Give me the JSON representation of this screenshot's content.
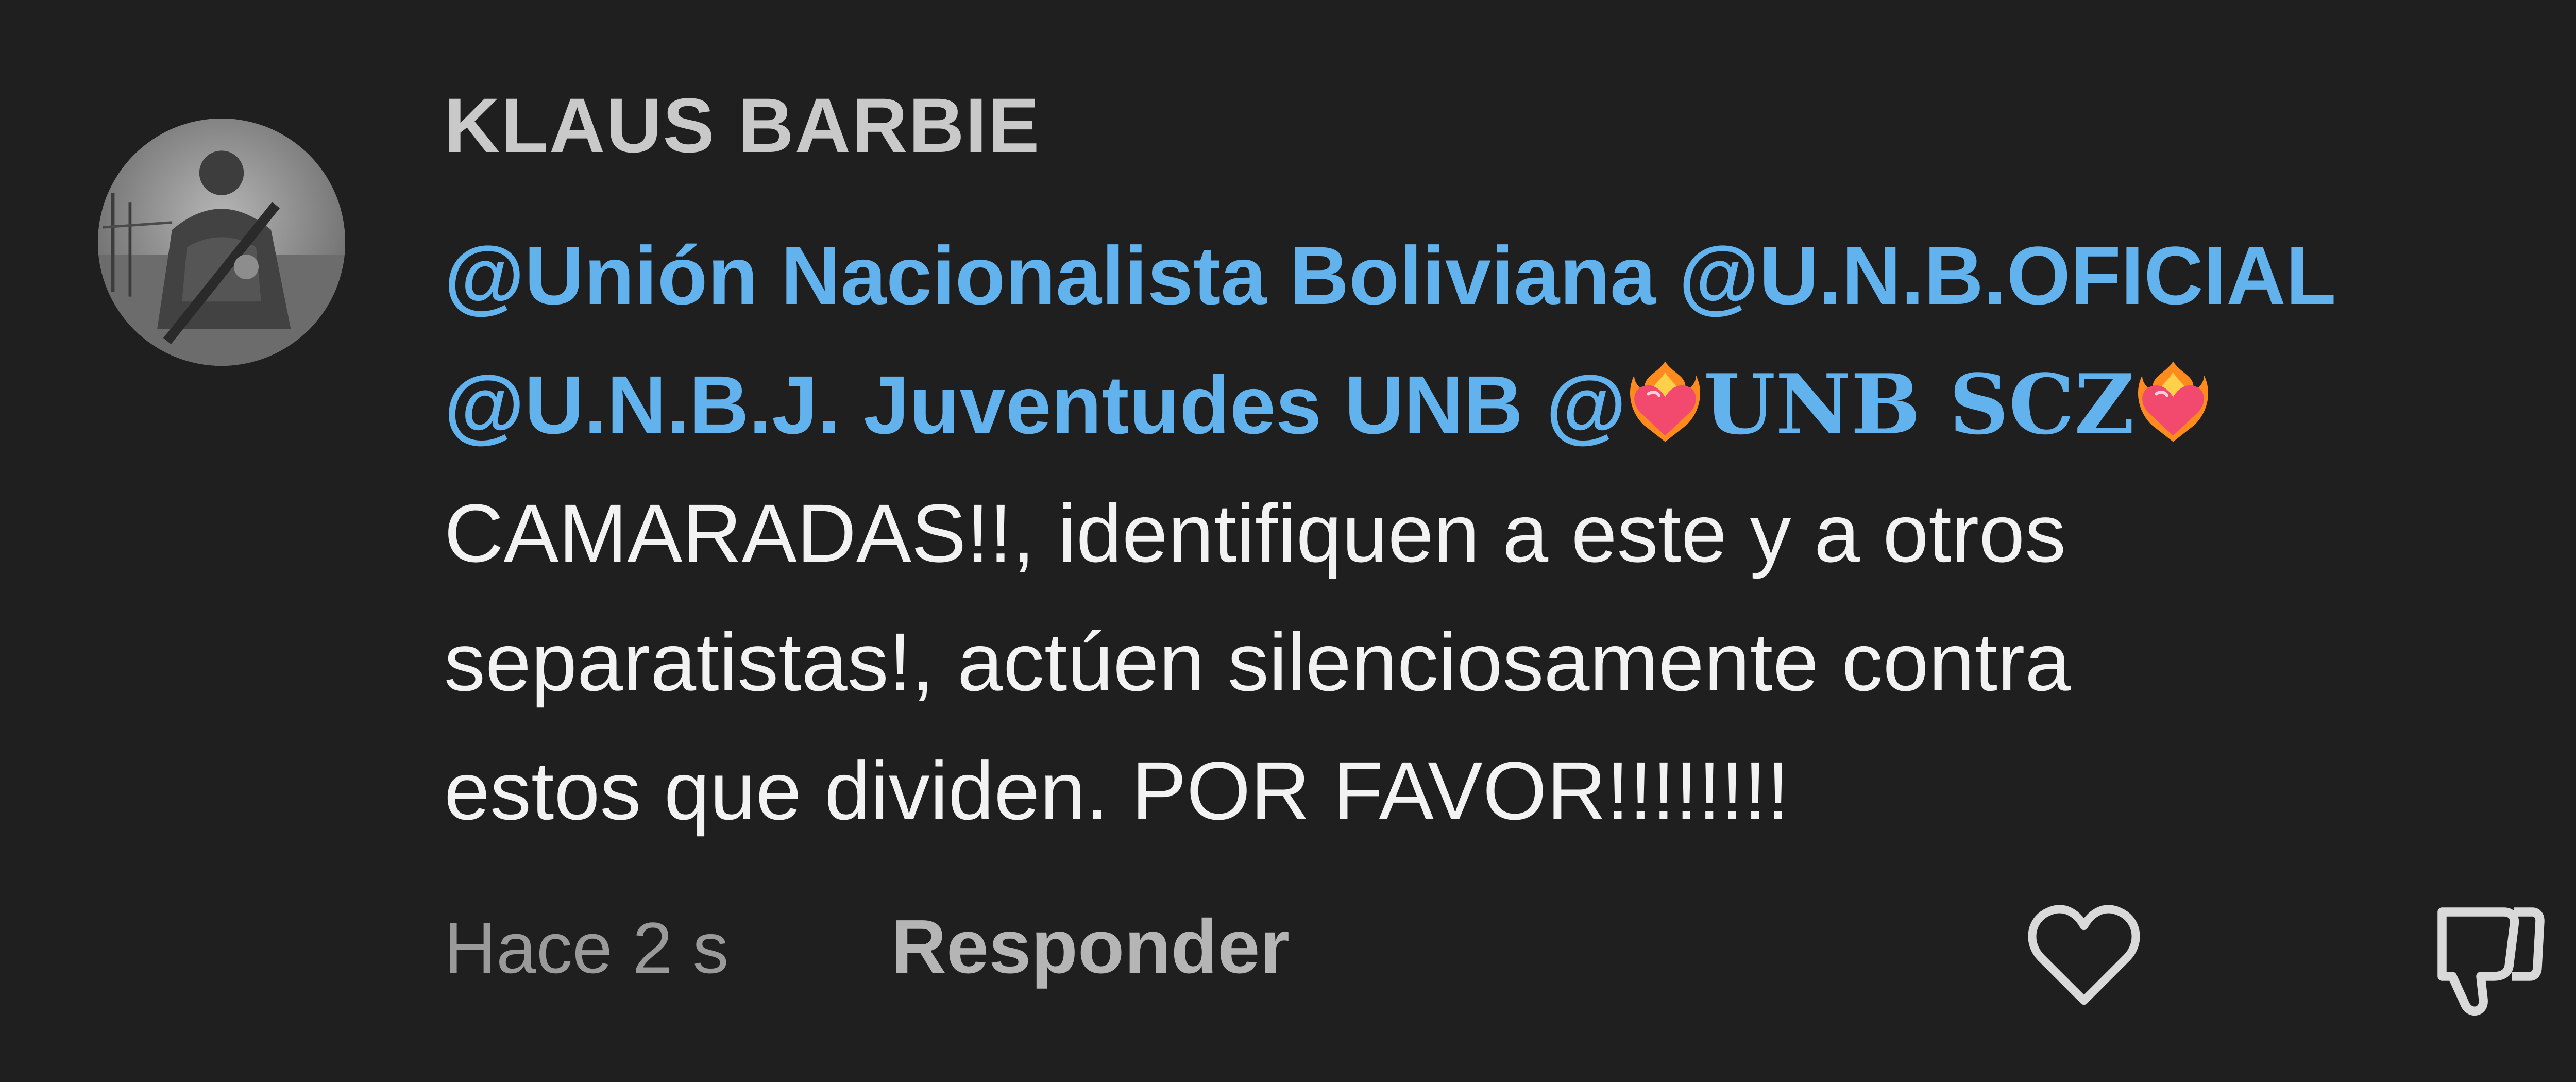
{
  "comment": {
    "username": "KLAUS BARBIE",
    "mentions": {
      "m1": "@Unión Nacionalista Boliviana",
      "m2": "@U.N.B.OFICIAL",
      "m3": "@U.N.B.J. Juventudes UNB",
      "m4_at": "@",
      "m4_name": "UNB SCZ"
    },
    "text_lines": [
      "CAMARADAS!!, identifiquen a este y a otros",
      "separatistas!, actúen silenciosamente contra",
      "estos que dividen. POR FAVOR!!!!!!!!"
    ],
    "timestamp": "Hace 2 s",
    "reply_label": "Responder"
  },
  "icons": {
    "avatar": "user-avatar",
    "emoji": "heart-on-fire-icon",
    "like": "heart-outline-icon",
    "dislike": "thumbs-down-icon"
  },
  "colors": {
    "background": "#1f1f1f",
    "mention": "#62b2ee",
    "username": "#c9c9c9",
    "text": "#f2f2f2",
    "muted": "#9a9a9a"
  }
}
